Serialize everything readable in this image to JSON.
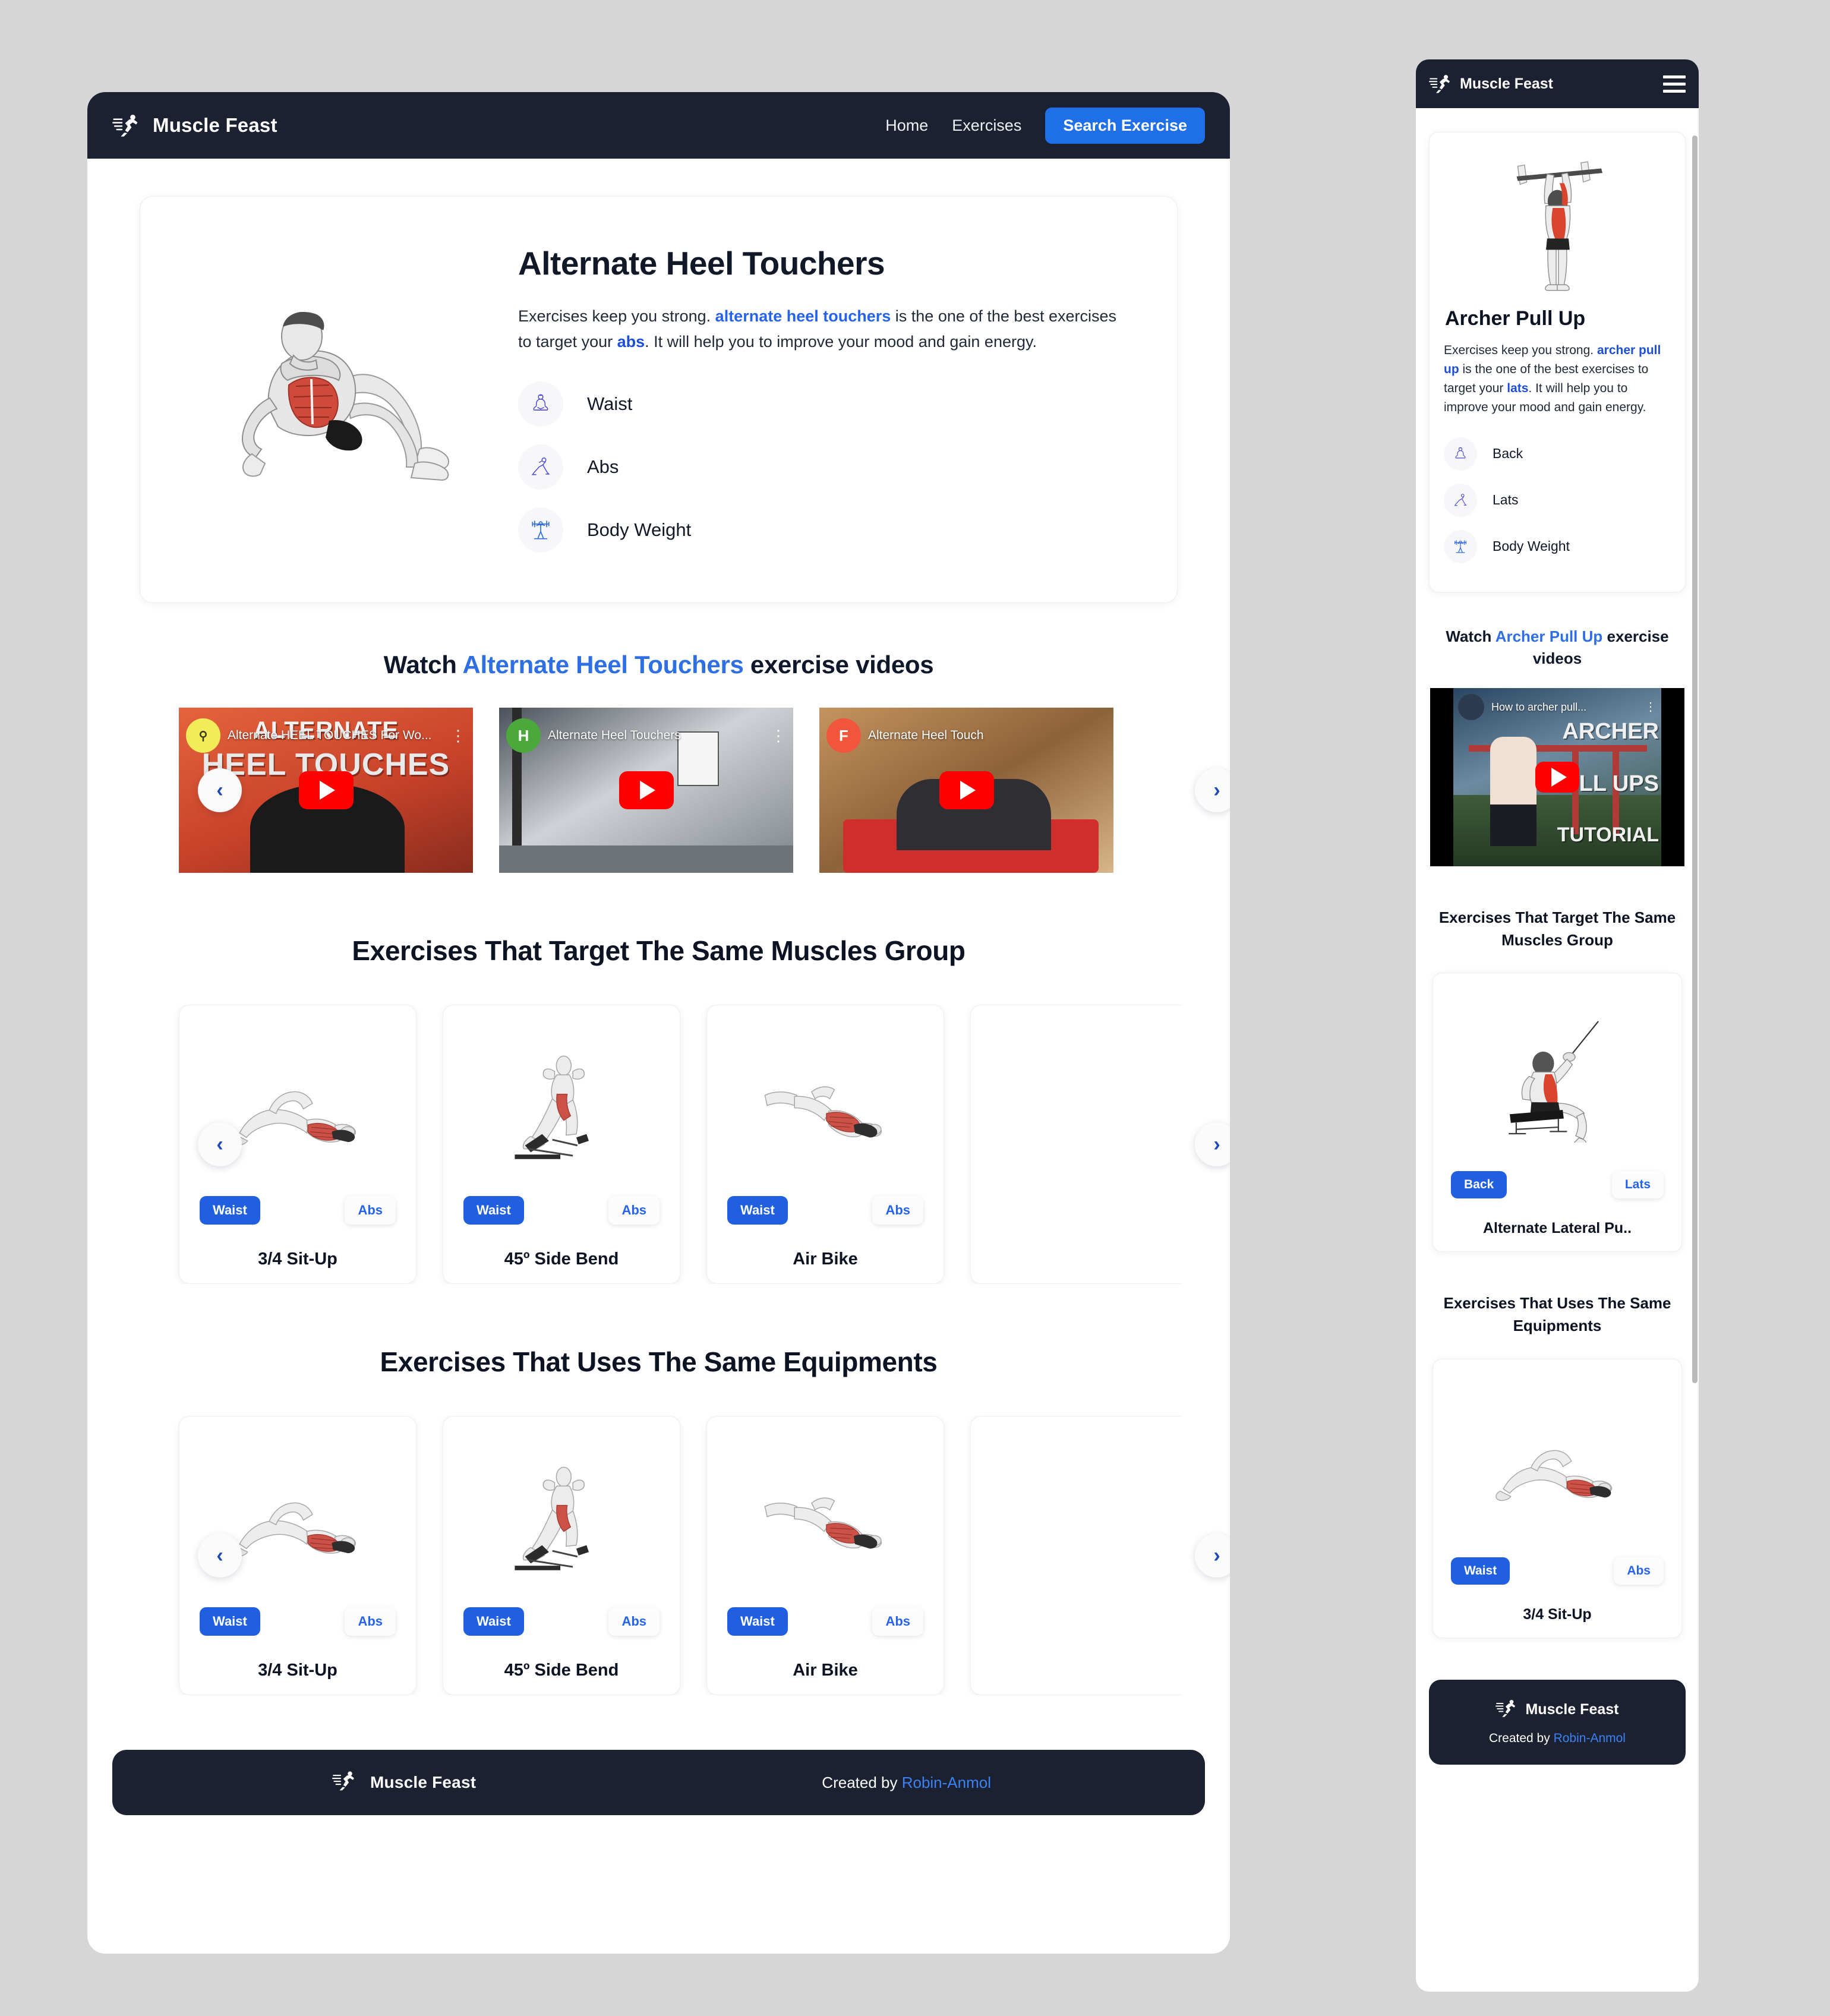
{
  "brand": {
    "name": "Muscle Feast",
    "logo_icon": "runner-icon"
  },
  "desktop": {
    "nav": {
      "links": [
        {
          "label": "Home",
          "name": "nav-home"
        },
        {
          "label": "Exercises",
          "name": "nav-exercises"
        }
      ],
      "cta_label": "Search Exercise"
    },
    "hero": {
      "title": "Alternate Heel Touchers",
      "desc_p1": "Exercises keep you strong. ",
      "desc_link1": "alternate heel touchers",
      "desc_p2": " is the one of the best exercises to target your ",
      "desc_link2": "abs",
      "desc_p3": ". It will help you to improve your mood and gain energy.",
      "meta": [
        {
          "label": "Waist",
          "icon": "meditation-icon"
        },
        {
          "label": "Abs",
          "icon": "lunge-icon"
        },
        {
          "label": "Body Weight",
          "icon": "barbell-lift-icon"
        }
      ]
    },
    "videos_heading": {
      "pre": "Watch ",
      "highlight": "Alternate Heel Touchers",
      "post": " exercise videos"
    },
    "videos": [
      {
        "title": "Alternate HEEL TOUCHES For Wo...",
        "channel_initial": "",
        "overlay": "HEEL TOUCHES",
        "overlay_top": "ALTERNATE"
      },
      {
        "title": "Alternate Heel Touchers",
        "channel_initial": "H",
        "overlay": "",
        "overlay_top": ""
      },
      {
        "title": "Alternate Heel Touch",
        "channel_initial": "F",
        "overlay": "",
        "overlay_top": ""
      }
    ],
    "section_muscles_title": "Exercises That Target The Same Muscles Group",
    "section_equipment_title": "Exercises That Uses The Same Equipments",
    "muscle_cards": [
      {
        "name": "3/4 Sit-Up",
        "tag_primary": "Waist",
        "tag_secondary": "Abs"
      },
      {
        "name": "45º Side Bend",
        "tag_primary": "Waist",
        "tag_secondary": "Abs"
      },
      {
        "name": "Air Bike",
        "tag_primary": "Waist",
        "tag_secondary": "Abs"
      }
    ],
    "equipment_cards": [
      {
        "name": "3/4 Sit-Up",
        "tag_primary": "Waist",
        "tag_secondary": "Abs"
      },
      {
        "name": "45º Side Bend",
        "tag_primary": "Waist",
        "tag_secondary": "Abs"
      },
      {
        "name": "Air Bike",
        "tag_primary": "Waist",
        "tag_secondary": "Abs"
      }
    ],
    "carousel": {
      "prev_label": "‹",
      "next_label": "›"
    },
    "footer": {
      "brand": "Muscle Feast",
      "created_by": "Created by ",
      "author": "Robin-Anmol"
    }
  },
  "mobile": {
    "nav": {
      "menu_icon": "hamburger-icon"
    },
    "hero": {
      "title": "Archer Pull Up",
      "desc_p1": "Exercises keep you strong. ",
      "desc_link1": "archer pull up",
      "desc_p2": " is the one of the best exercises to target your ",
      "desc_link2": "lats",
      "desc_p3": ". It will help you to improve your mood and gain energy.",
      "meta": [
        {
          "label": "Back",
          "icon": "meditation-icon"
        },
        {
          "label": "Lats",
          "icon": "lunge-icon"
        },
        {
          "label": "Body Weight",
          "icon": "barbell-lift-icon"
        }
      ]
    },
    "videos_heading": {
      "pre": "Watch ",
      "highlight": "Archer Pull Up",
      "post": " exercise videos"
    },
    "video": {
      "title": "How to archer pull...",
      "overlay_1": "ARCHER",
      "overlay_2": "LL UPS",
      "overlay_3": "TUTORIAL"
    },
    "section_muscles_title": "Exercises That Target The Same Muscles Group",
    "section_equipment_title": "Exercises That Uses The Same Equipments",
    "muscle_card": {
      "name": "Alternate Lateral Pu..",
      "tag_primary": "Back",
      "tag_secondary": "Lats"
    },
    "equipment_card": {
      "name": "3/4 Sit-Up",
      "tag_primary": "Waist",
      "tag_secondary": "Abs"
    },
    "footer": {
      "brand": "Muscle Feast",
      "created_by": "Created by ",
      "author": "Robin-Anmol"
    }
  },
  "colors": {
    "accent": "#1f5fe0",
    "link": "#2563eb",
    "dark": "#1b2130",
    "page_bg": "#d6d6d6"
  }
}
